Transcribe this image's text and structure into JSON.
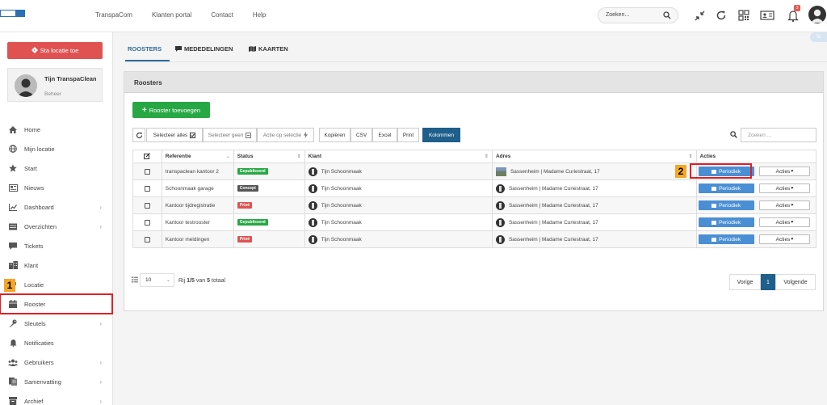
{
  "colors": {
    "accent": "#2e6d9e",
    "danger": "#e05252",
    "success": "#27a844",
    "primary": "#4a8fd4",
    "highlight": "#e21e26",
    "marker": "#f5a623"
  },
  "logo": {
    "left_text": "",
    "right_text": ""
  },
  "topnav": [
    "TranspaCom",
    "Klanten portal",
    "Contact",
    "Help"
  ],
  "top_search": {
    "placeholder": "Zoeken..."
  },
  "notifications": {
    "count": "3"
  },
  "top_icons": [
    "compress-icon",
    "refresh-icon",
    "qr-icon",
    "id-card-icon",
    "bell-icon",
    "user-avatar"
  ],
  "sidebar": {
    "location_button": "Sta locatie toe",
    "user": {
      "name": "Tijn TranspaClean",
      "role": "Beheer"
    },
    "items": [
      {
        "label": "Home",
        "icon": "home-icon",
        "chevron": false
      },
      {
        "label": "Mijn locatie",
        "icon": "globe-icon",
        "chevron": false
      },
      {
        "label": "Start",
        "icon": "star-icon",
        "chevron": false
      },
      {
        "label": "Nieuws",
        "icon": "newspaper-icon",
        "chevron": false
      },
      {
        "label": "Dashboard",
        "icon": "chart-icon",
        "chevron": true
      },
      {
        "label": "Overzichten",
        "icon": "list-icon",
        "chevron": true
      },
      {
        "label": "Tickets",
        "icon": "comment-icon",
        "chevron": false
      },
      {
        "label": "Klant",
        "icon": "building-icon",
        "chevron": false
      },
      {
        "label": "Locatie",
        "icon": "pin-icon",
        "chevron": false
      },
      {
        "label": "Rooster",
        "icon": "calendar-icon",
        "chevron": false
      },
      {
        "label": "Sleutels",
        "icon": "key-icon",
        "chevron": true
      },
      {
        "label": "Notificaties",
        "icon": "bell-icon",
        "chevron": false
      },
      {
        "label": "Gebruikers",
        "icon": "users-icon",
        "chevron": true
      },
      {
        "label": "Samenvatting",
        "icon": "doc-icon",
        "chevron": true
      },
      {
        "label": "Archief",
        "icon": "archive-icon",
        "chevron": true
      }
    ]
  },
  "markers": {
    "one": "1",
    "two": "2"
  },
  "tabs": [
    {
      "label": "ROOSTERS",
      "active": true
    },
    {
      "label": "MEDEDELINGEN",
      "active": false
    },
    {
      "label": "KAARTEN",
      "active": false
    }
  ],
  "edge_tab": "Te",
  "panel": {
    "title": "Roosters",
    "add_button": "Rooster toevoegen",
    "toolbar": {
      "select_all": "Selecteer alles",
      "select_none": "Selecteer geen",
      "action_on_selection": "Actie op selectie",
      "copy": "Kopiëren",
      "csv": "CSV",
      "excel": "Excel",
      "print": "Print",
      "columns": "Kolommen"
    },
    "search_placeholder": "Zoeken ...",
    "table": {
      "headers": [
        "Referentie",
        "Status",
        "Klant",
        "Adres",
        "Acties"
      ],
      "rows": [
        {
          "referentie": "transpaclean kantoor 2",
          "status": "Gepubliceerd",
          "status_color": "#27a844",
          "klant": "Tijn Schoonmaak",
          "adres": "Sassenheim | Madame Curiestraat, 17",
          "periodiek": "Periodiek",
          "acties": "Acties"
        },
        {
          "referentie": "Schoonmaak garage",
          "status": "Concept",
          "status_color": "#555555",
          "klant": "Tijn Schoonmaak",
          "adres": "Sassenheim | Madame Curiestraat, 17",
          "periodiek": "Periodiek",
          "acties": "Acties"
        },
        {
          "referentie": "Kantoor tijdregistratie",
          "status": "Privé",
          "status_color": "#e05252",
          "klant": "Tijn Schoonmaak",
          "adres": "Sassenheim | Madame Curiestraat, 17",
          "periodiek": "Periodiek",
          "acties": "Acties"
        },
        {
          "referentie": "Kantoor testrooster",
          "status": "Gepubliceerd",
          "status_color": "#27a844",
          "klant": "Tijn Schoonmaak",
          "adres": "Sassenheim | Madame Curiestraat, 17",
          "periodiek": "Periodiek",
          "acties": "Acties"
        },
        {
          "referentie": "Kantoor meldingen",
          "status": "Privé",
          "status_color": "#e05252",
          "klant": "Tijn Schoonmaak",
          "adres": "Sassenheim | Madame Curiestraat, 17",
          "periodiek": "Periodiek",
          "acties": "Acties"
        }
      ]
    },
    "pager": {
      "page_size": "10",
      "info_prefix": "Rij",
      "info_range": "1/5",
      "info_mid": "van",
      "info_total": "5",
      "info_suffix": "totaal",
      "prev": "Vorige",
      "current": "1",
      "next": "Volgende"
    }
  }
}
